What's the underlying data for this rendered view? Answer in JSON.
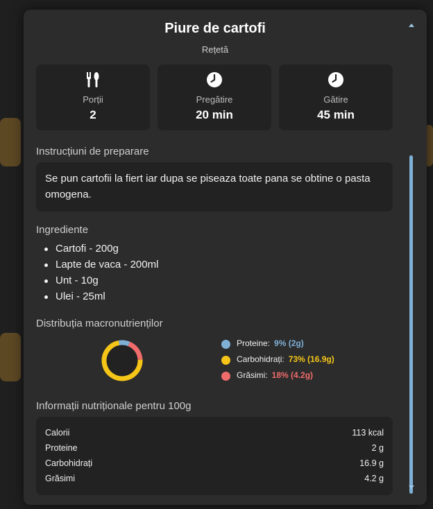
{
  "recipe": {
    "title": "Piure de cartofi",
    "subtitle": "Rețetă"
  },
  "stats": [
    {
      "icon": "utensils-icon",
      "label": "Porții",
      "value": "2"
    },
    {
      "icon": "clock-icon",
      "label": "Pregătire",
      "value": "20 min"
    },
    {
      "icon": "clock-icon",
      "label": "Gătire",
      "value": "45 min"
    }
  ],
  "instructions": {
    "heading": "Instrucțiuni de preparare",
    "text": "Se pun cartofii la fiert iar dupa se piseaza toate pana se obtine o pasta omogena."
  },
  "ingredients": {
    "heading": "Ingrediente",
    "items": [
      "Cartofi - 200g",
      "Lapte de vaca - 200ml",
      "Unt - 10g",
      "Ulei - 25ml"
    ]
  },
  "macros": {
    "heading": "Distribuția macronutrienților",
    "items": [
      {
        "label": "Proteine:",
        "value": "9% (2g)",
        "percent": 9,
        "color": "#7fb0d6"
      },
      {
        "label": "Carbohidrați:",
        "value": "73% (16.9g)",
        "percent": 73,
        "color": "#f5c518"
      },
      {
        "label": "Grăsimi:",
        "value": "18% (4.2g)",
        "percent": 18,
        "color": "#f06b6b"
      }
    ]
  },
  "nutrition": {
    "heading": "Informații nutriționale pentru 100g",
    "rows": [
      {
        "label": "Calorii",
        "value": "113 kcal"
      },
      {
        "label": "Proteine",
        "value": "2 g"
      },
      {
        "label": "Carbohidrați",
        "value": "16.9 g"
      },
      {
        "label": "Grăsimi",
        "value": "4.2 g"
      }
    ]
  },
  "colors": {
    "background": "#1b1b1b",
    "modal": "#2c2c2c",
    "card": "#222222",
    "accent": "#7fb0d6"
  }
}
